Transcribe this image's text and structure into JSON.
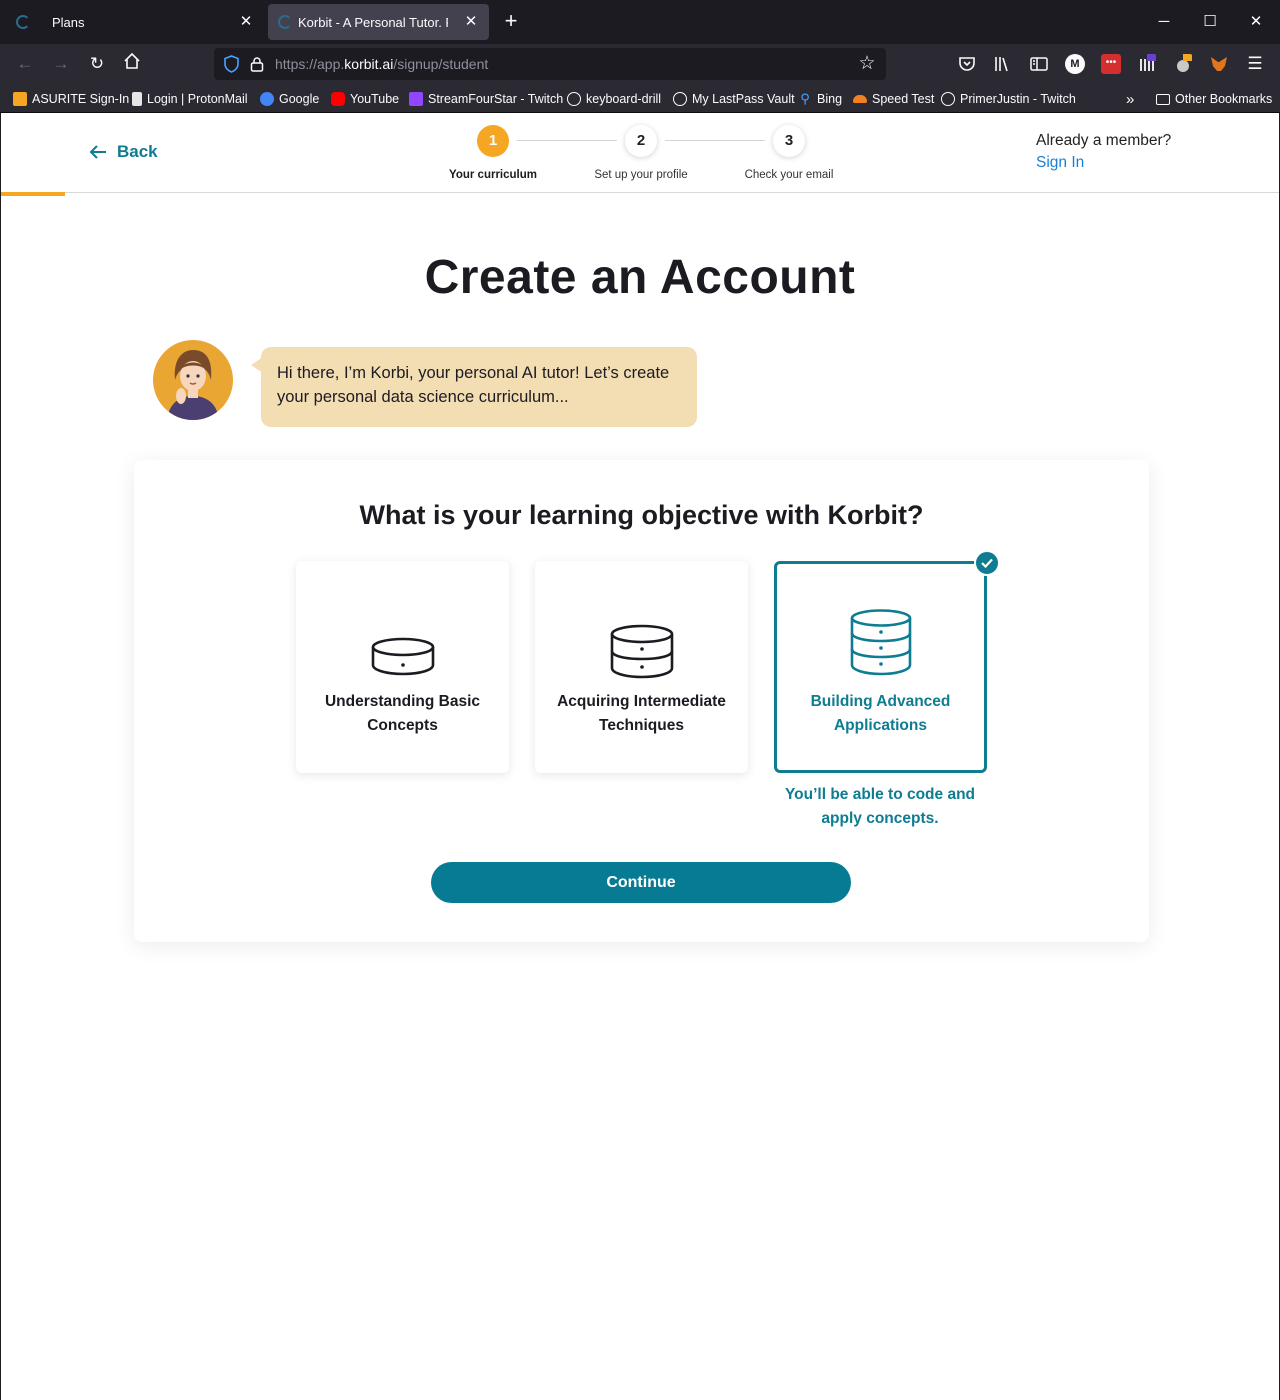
{
  "browser": {
    "tabs": [
      {
        "title": "Plans"
      },
      {
        "title": "Korbit - A Personal Tutor. For Ev"
      }
    ],
    "url_prefix": "https://app.",
    "url_host": "korbit.ai",
    "url_path": "/signup/student",
    "bookmarks": [
      {
        "label": "ASURITE Sign-In",
        "icon": "asurite-icon",
        "color": "#f5a623"
      },
      {
        "label": "Login | ProtonMail",
        "icon": "lock-icon",
        "color": "#e6e6e6"
      },
      {
        "label": "Google",
        "icon": "google-icon",
        "color": "#4285f4"
      },
      {
        "label": "YouTube",
        "icon": "youtube-icon",
        "color": "#ff0000"
      },
      {
        "label": "StreamFourStar - Twitch",
        "icon": "twitch-icon",
        "color": "#9146ff"
      },
      {
        "label": "keyboard-drill",
        "icon": "globe-icon",
        "color": ""
      },
      {
        "label": "My LastPass Vault",
        "icon": "globe-icon",
        "color": ""
      },
      {
        "label": "Bing",
        "icon": "search-icon",
        "color": "#4aa3ff"
      },
      {
        "label": "Speed Test",
        "icon": "cloudflare-icon",
        "color": "#f38020"
      },
      {
        "label": "PrimerJustin - Twitch",
        "icon": "globe-icon",
        "color": ""
      }
    ],
    "other_bookmarks": "Other Bookmarks"
  },
  "header": {
    "back_label": "Back",
    "steps": [
      {
        "number": "1",
        "label": "Your curriculum",
        "active": true
      },
      {
        "number": "2",
        "label": "Set up your profile",
        "active": false
      },
      {
        "number": "3",
        "label": "Check your email",
        "active": false
      }
    ],
    "member_text": "Already a member?",
    "signin_label": "Sign In"
  },
  "main": {
    "title": "Create an Account",
    "tutor_message": "Hi there, I’m Korbi, your personal AI tutor! Let’s create your personal data science curriculum...",
    "question": "What is your learning objective with Korbit?",
    "options": [
      {
        "label": "Understanding Basic Concepts",
        "icon": "database-1-icon",
        "selected": false
      },
      {
        "label": "Acquiring Intermediate Techniques",
        "icon": "database-2-icon",
        "selected": false
      },
      {
        "label": "Building Advanced Applications",
        "icon": "database-3-icon",
        "selected": true
      }
    ],
    "selected_description": "You’ll be able to code and apply concepts.",
    "continue_label": "Continue"
  },
  "colors": {
    "accent": "#0e7c91",
    "step_active": "#f5a623",
    "bubble": "#f3ddb3",
    "link": "#1a7fd4"
  }
}
